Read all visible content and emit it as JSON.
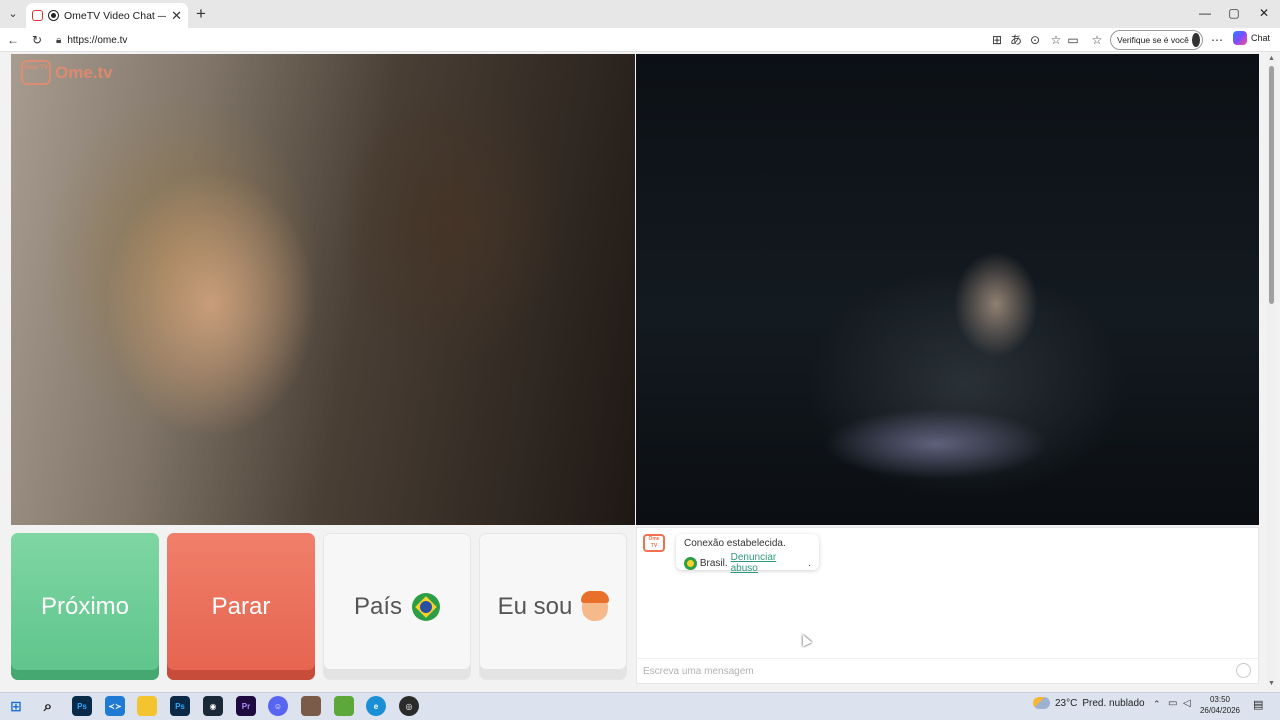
{
  "browser": {
    "tab_title": "OmeTV Video Chat — Omegle",
    "tab_close": "✕",
    "new_tab": "+",
    "url": "https://ome.tv",
    "verify_label": "Verifique se é você",
    "copilot_label": "Chat",
    "window_controls": {
      "minimize": "—",
      "maximize": "▢",
      "close": "✕"
    }
  },
  "logo": {
    "badge": "Ome TV",
    "word": "Ome.tv"
  },
  "actions": {
    "next": "Próximo",
    "stop": "Parar",
    "country": "País",
    "gender": "Eu sou"
  },
  "chat": {
    "logo_badge": "Ome TV",
    "status": "Conexão estabelecida.",
    "country": "Brasil.",
    "report_link": "Denunciar abuso",
    "report_suffix": ".",
    "input_placeholder": "Escreva uma mensagem"
  },
  "taskbar": {
    "apps": [
      "Ps",
      "Ps",
      "Pr"
    ],
    "weather_temp": "23°C",
    "weather_desc": "Pred. nublado",
    "time": "03:50",
    "date": "26/04/2026"
  },
  "colors": {
    "next_green": "#5dc48a",
    "stop_red": "#e5634e",
    "brand_orange": "#f28a6a",
    "link_teal": "#2f9a7a"
  }
}
